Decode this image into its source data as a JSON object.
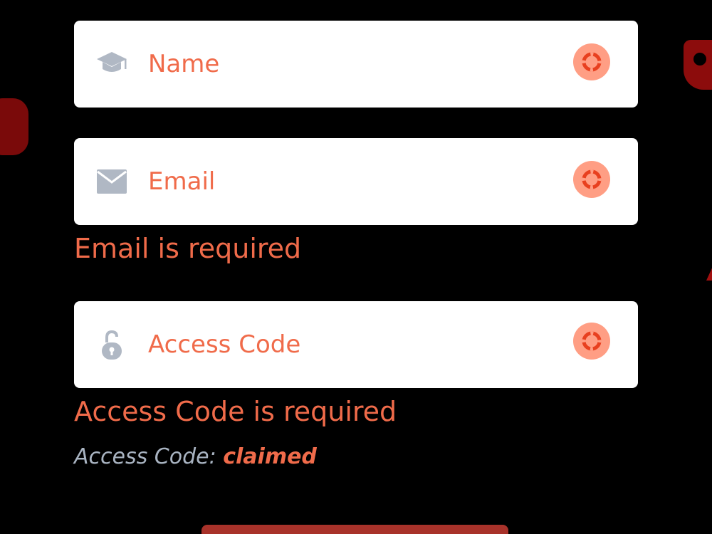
{
  "form": {
    "name_field": {
      "placeholder": "Name",
      "value": "",
      "icon": "graduation-cap-icon",
      "action_icon": "lifebuoy-icon"
    },
    "email_field": {
      "placeholder": "Email",
      "value": "",
      "icon": "envelope-icon",
      "action_icon": "lifebuoy-icon",
      "error": "Email is required"
    },
    "access_code_field": {
      "placeholder": "Access Code",
      "value": "",
      "icon": "unlock-icon",
      "action_icon": "lifebuoy-icon",
      "error": "Access Code is required"
    },
    "status": {
      "label": "Access Code:",
      "value": "claimed"
    }
  },
  "colors": {
    "accent": "#f06b4a",
    "action_bg": "#ff9e84",
    "icon_gray": "#b0b8c4",
    "button": "#a8322a",
    "background": "#000000"
  }
}
